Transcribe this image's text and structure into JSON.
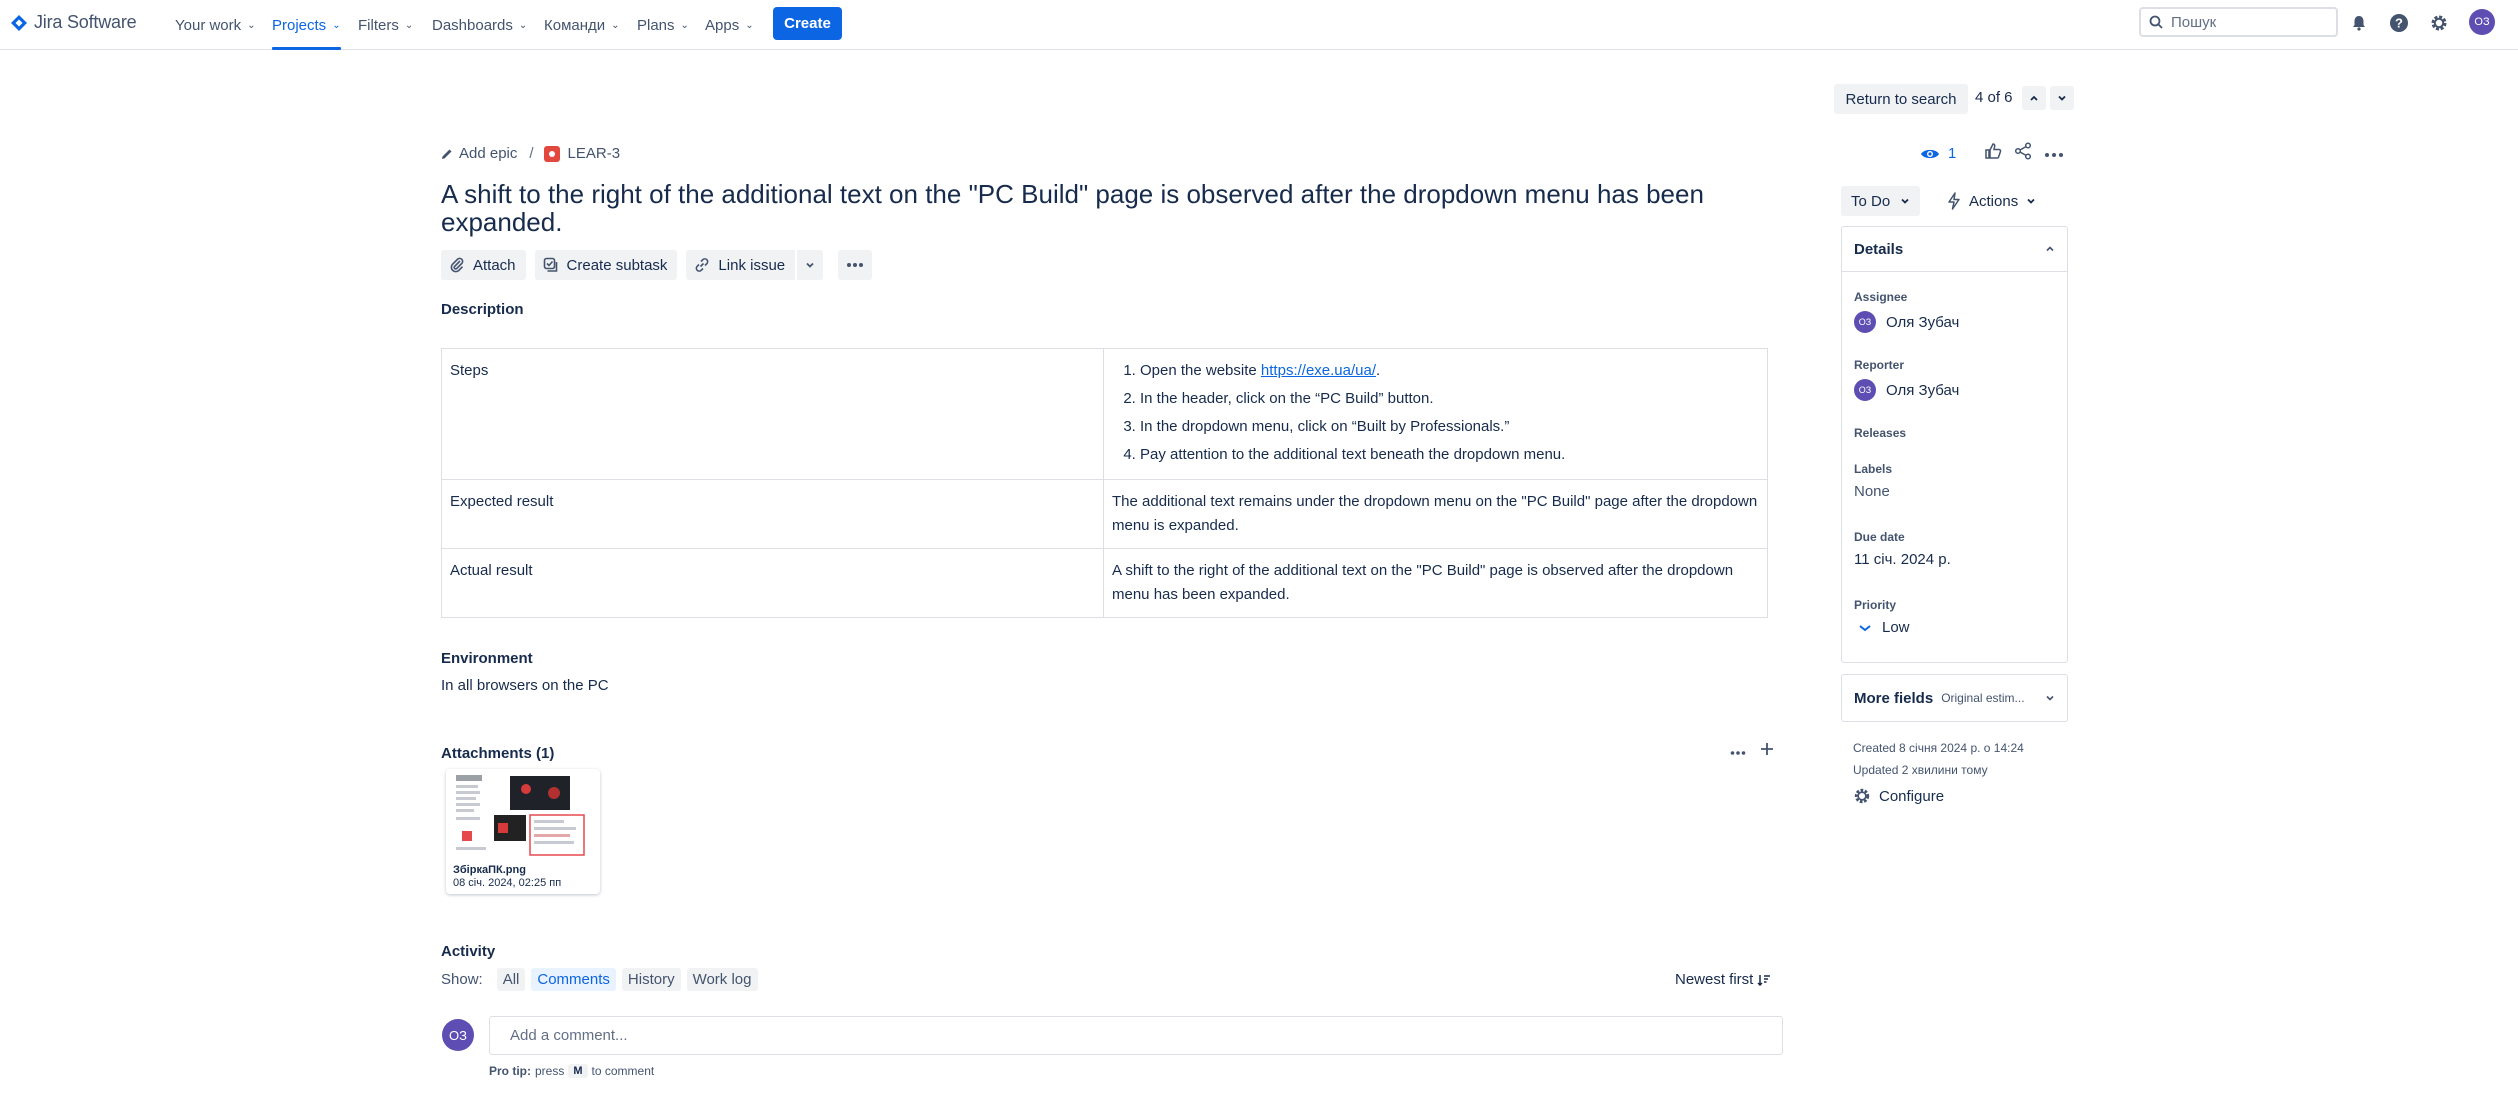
{
  "app": {
    "name": "Jira Software"
  },
  "nav": {
    "items": [
      {
        "label": "Your work"
      },
      {
        "label": "Projects"
      },
      {
        "label": "Filters"
      },
      {
        "label": "Dashboards"
      },
      {
        "label": "Команди"
      },
      {
        "label": "Plans"
      },
      {
        "label": "Apps"
      }
    ],
    "active": "Projects",
    "create_label": "Create",
    "search_placeholder": "Пошук",
    "user_initials": "ОЗ"
  },
  "issue_nav": {
    "return_label": "Return to search",
    "pager_text": "4 of 6"
  },
  "breadcrumb": {
    "epic_label": "Add epic",
    "separator": "/",
    "issue_key": "LEAR-3"
  },
  "issue": {
    "title": "A shift to the right of the additional text on the \"PC Build\" page is observed after the dropdown menu has been expanded."
  },
  "toolbar": {
    "attach": "Attach",
    "create_subtask": "Create subtask",
    "link_issue": "Link issue"
  },
  "description": {
    "label": "Description",
    "rows": [
      {
        "name": "Steps",
        "steps_prefix": "Open the website ",
        "steps_link": "https://exe.ua/ua/",
        "steps_suffix": ".",
        "steps": [
          "In the header, click on the “PC Build” button.",
          "In the dropdown menu, click on “Built by Professionals.”",
          "Pay attention to the additional text beneath the dropdown menu."
        ]
      },
      {
        "name": "Expected result",
        "value": "The additional text remains under the dropdown menu on the \"PC Build\" page after the dropdown menu is expanded."
      },
      {
        "name": "Actual result",
        "value": "A shift to the right of the additional text on the \"PC Build\" page is observed after the dropdown menu has been expanded."
      }
    ]
  },
  "environment": {
    "label": "Environment",
    "value": "In all browsers on the PC"
  },
  "attachments": {
    "label": "Attachments (1)",
    "files": [
      {
        "name": "ЗбіркаПК.png",
        "date": "08 січ. 2024, 02:25 пп"
      }
    ]
  },
  "activity": {
    "label": "Activity",
    "show_label": "Show:",
    "tabs": [
      "All",
      "Comments",
      "History",
      "Work log"
    ],
    "selected_tab": "Comments",
    "sort_label": "Newest first",
    "comment_placeholder": "Add a comment...",
    "protip_bold": "Pro tip:",
    "protip_text": "press",
    "protip_key": "M",
    "protip_suffix": "to comment",
    "avatar_initials": "ОЗ"
  },
  "sidebar": {
    "watchers_count": "1",
    "status": "To Do",
    "actions_label": "Actions",
    "details": {
      "title": "Details",
      "assignee_label": "Assignee",
      "assignee": "Оля Зубач",
      "reporter_label": "Reporter",
      "reporter": "Оля Зубач",
      "avatar_initials": "ОЗ",
      "releases_label": "Releases",
      "labels_label": "Labels",
      "labels_value": "None",
      "due_label": "Due date",
      "due_value": "11 січ. 2024 р.",
      "priority_label": "Priority",
      "priority_value": "Low"
    },
    "more_fields": {
      "title": "More fields",
      "subtitle": "Original estim..."
    },
    "created": "Created 8 січня 2024 р. о 14:24",
    "updated": "Updated 2 хвилини тому",
    "configure_label": "Configure"
  },
  "colors": {
    "brand_blue": "#0c66e4",
    "avatar_purple": "#5e4db2",
    "bug_red": "#e2483d"
  }
}
